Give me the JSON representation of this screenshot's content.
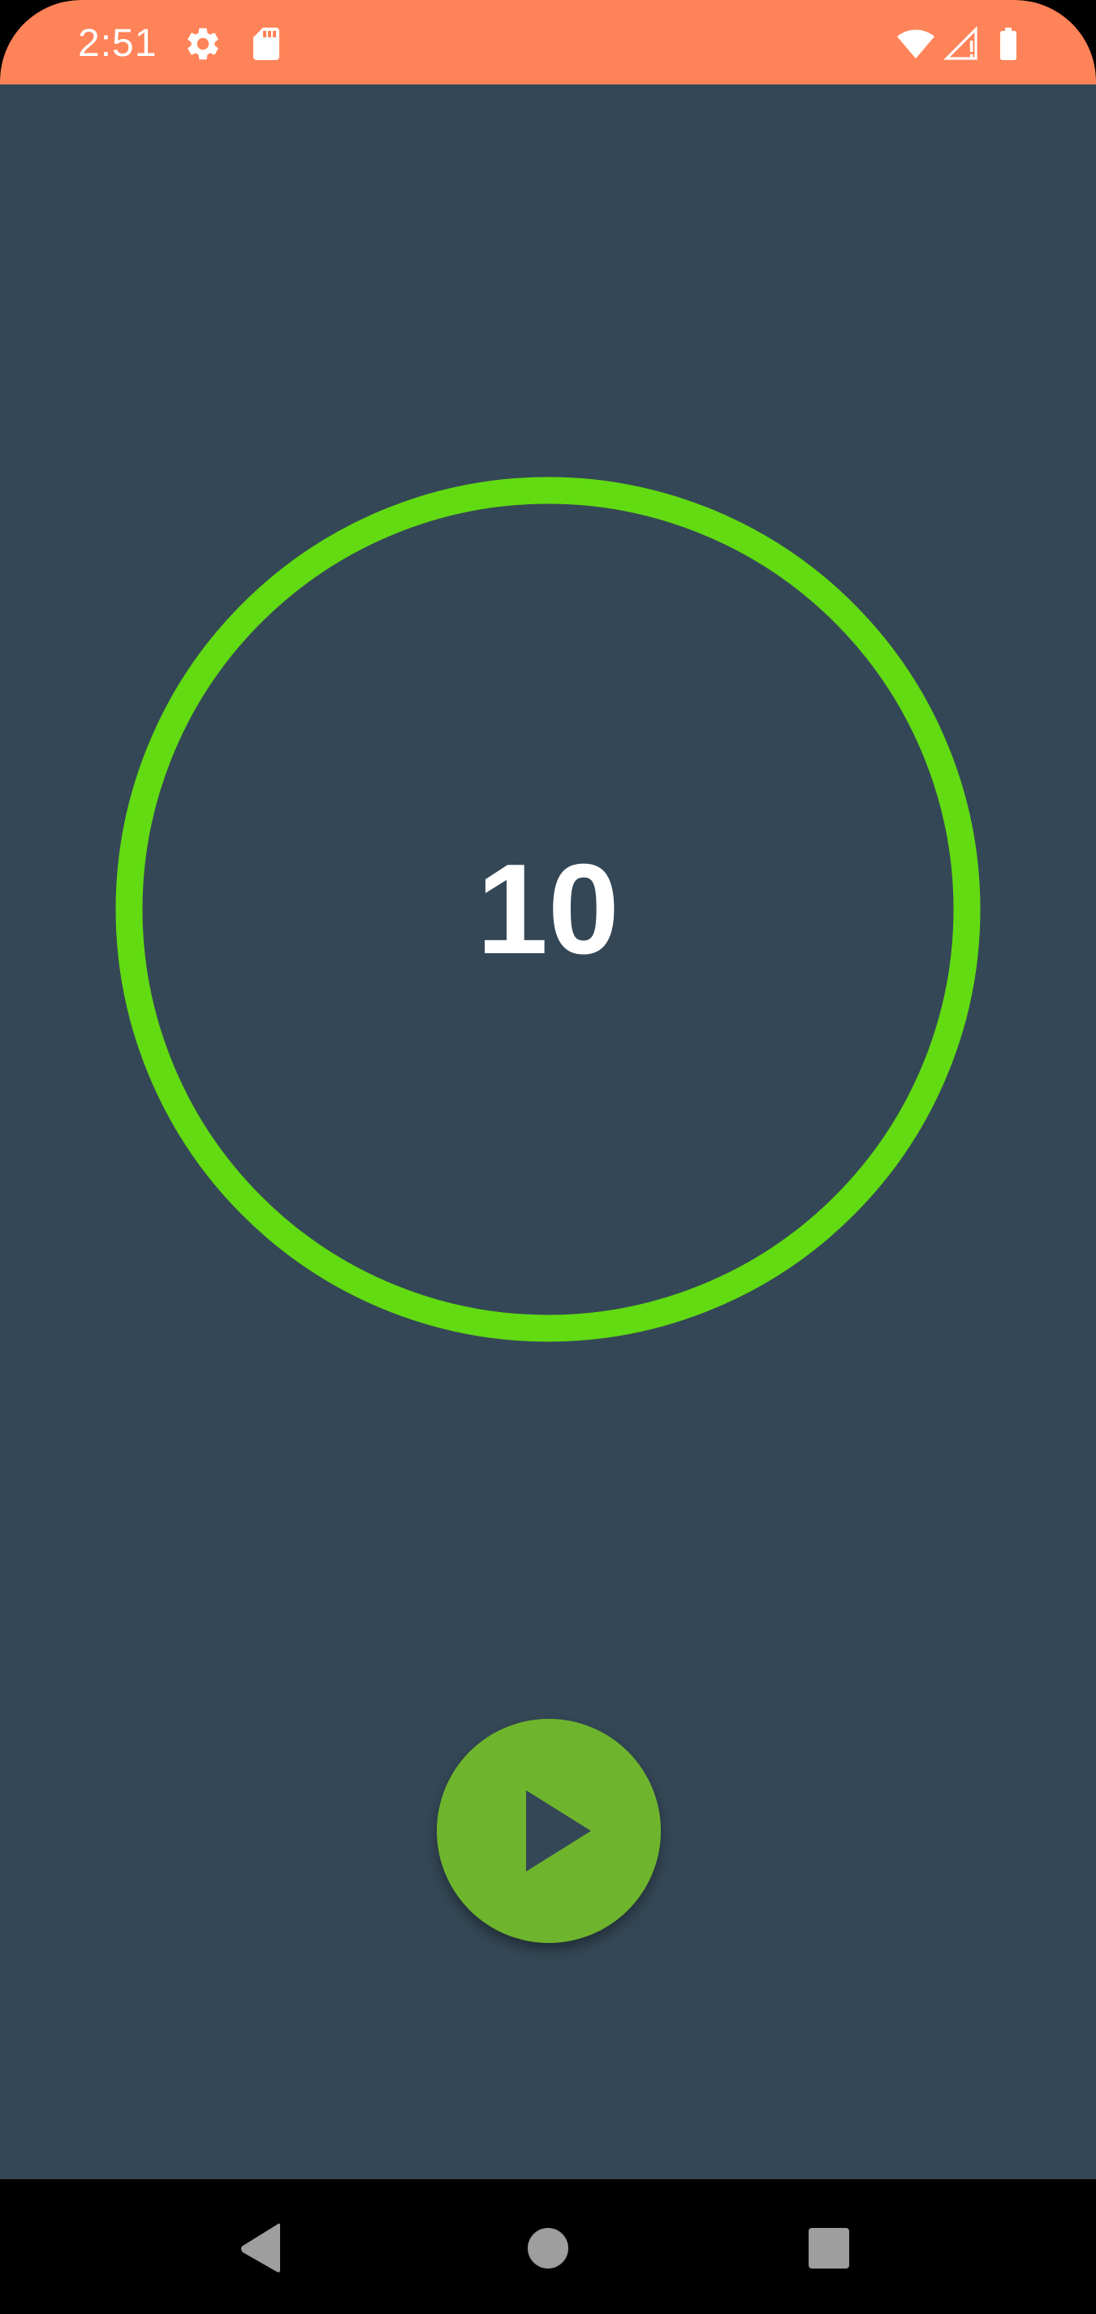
{
  "status_bar": {
    "time": "2:51",
    "left_icons": [
      "settings-gear-icon",
      "sd-card-icon"
    ],
    "right_icons": [
      "wifi-icon",
      "cellular-signal-alert-icon",
      "battery-icon"
    ]
  },
  "timer": {
    "value": "10",
    "ring_color": "#62DB12"
  },
  "controls": {
    "play_icon": "play-icon",
    "play_color": "#6EB52D"
  },
  "nav_bar": {
    "buttons": [
      "back-icon",
      "home-icon",
      "recents-icon"
    ]
  },
  "colors": {
    "status_bar": "#FF8358",
    "background": "#344756",
    "nav_bar": "#000000"
  }
}
